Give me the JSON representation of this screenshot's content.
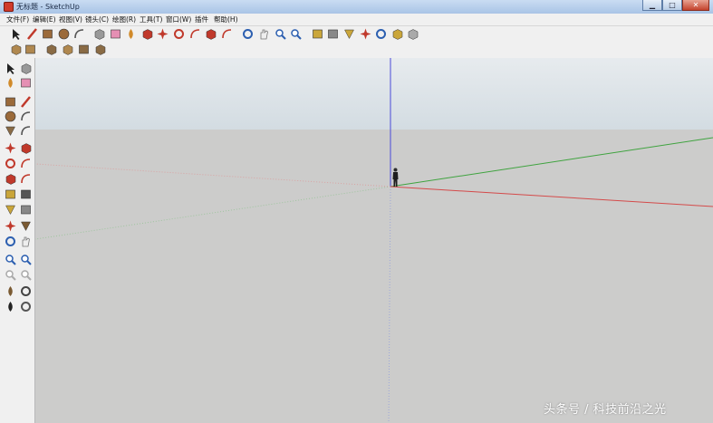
{
  "window": {
    "title": "无标题 - SketchUp",
    "minimize_glyph": "▁",
    "maximize_glyph": "□",
    "close_glyph": "✕"
  },
  "menu": [
    "文件(F)",
    "编辑(E)",
    "视图(V)",
    "镜头(C)",
    "绘图(R)",
    "工具(T)",
    "窗口(W)",
    "插件",
    "帮助(H)"
  ],
  "toolbar_top": [
    "select-icon",
    "pencil-icon",
    "rectangle-icon",
    "circle-icon",
    "arc-icon",
    "make-component-icon",
    "eraser-icon",
    "paint-bucket-icon",
    "push-pull-icon",
    "move-icon",
    "rotate-icon",
    "follow-me-icon",
    "scale-icon",
    "offset-icon",
    "orbit-icon",
    "pan-icon",
    "zoom-icon",
    "zoom-extents-icon",
    "tape-measure-icon",
    "text-icon",
    "protractor-icon",
    "axes-icon",
    "3d-warehouse-icon",
    "share-model-icon",
    "components-icon"
  ],
  "toolbar_views": [
    "iso-view-icon",
    "top-view-icon",
    "front-view-icon",
    "right-view-icon",
    "back-view-icon",
    "left-view-icon"
  ],
  "toolbar_left": [
    "select-icon",
    "make-component-icon",
    "paint-bucket-icon",
    "eraser-icon",
    "rectangle-icon",
    "line-icon",
    "circle-icon",
    "arc-icon",
    "polygon-icon",
    "freehand-icon",
    "move-icon",
    "push-pull-icon",
    "rotate-icon",
    "follow-me-icon",
    "scale-icon",
    "offset-icon",
    "tape-measure-icon",
    "dimension-icon",
    "protractor-icon",
    "text-icon",
    "axes-icon",
    "3d-text-icon",
    "orbit-icon",
    "pan-icon",
    "zoom-icon",
    "zoom-window-icon",
    "previous-view-icon",
    "next-view-icon",
    "position-camera-icon",
    "look-around-icon",
    "walk-icon",
    "section-plane-icon"
  ],
  "watermark": "头条号 / 科技前沿之光",
  "colors": {
    "red_axis": "#d44a4a",
    "green_axis": "#3fa33f",
    "blue_axis": "#4a4ad8",
    "ground": "#cccccb",
    "sky": "#dde3e8"
  }
}
